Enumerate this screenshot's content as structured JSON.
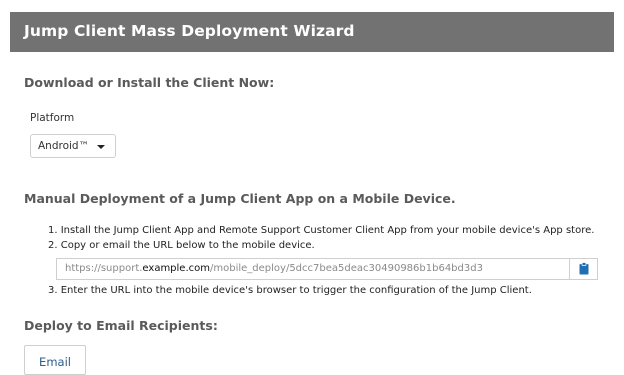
{
  "header": {
    "title": "Jump Client Mass Deployment Wizard"
  },
  "download": {
    "title": "Download or Install the Client Now:",
    "platform_label": "Platform",
    "platform_value": "Android™"
  },
  "manual": {
    "title": "Manual Deployment of a Jump Client App on a Mobile Device.",
    "steps": [
      "1. Install the Jump Client App and Remote Support Customer Client App from your mobile device's App store.",
      "2. Copy or email the URL below to the mobile device.",
      "3. Enter the URL into the mobile device's browser to trigger the configuration of the Jump Client."
    ],
    "url": {
      "prefix": "https://support.",
      "domain": "example.com",
      "suffix": "/mobile_deploy/5dcc7bea5deac30490986b1b64bd3d3"
    },
    "copy_icon": "clipboard-icon"
  },
  "email": {
    "title": "Deploy to Email Recipients:",
    "button_label": "Email"
  },
  "colors": {
    "header_bg": "#727272",
    "accent": "#2a5d8c",
    "icon": "#1f6fb2"
  }
}
